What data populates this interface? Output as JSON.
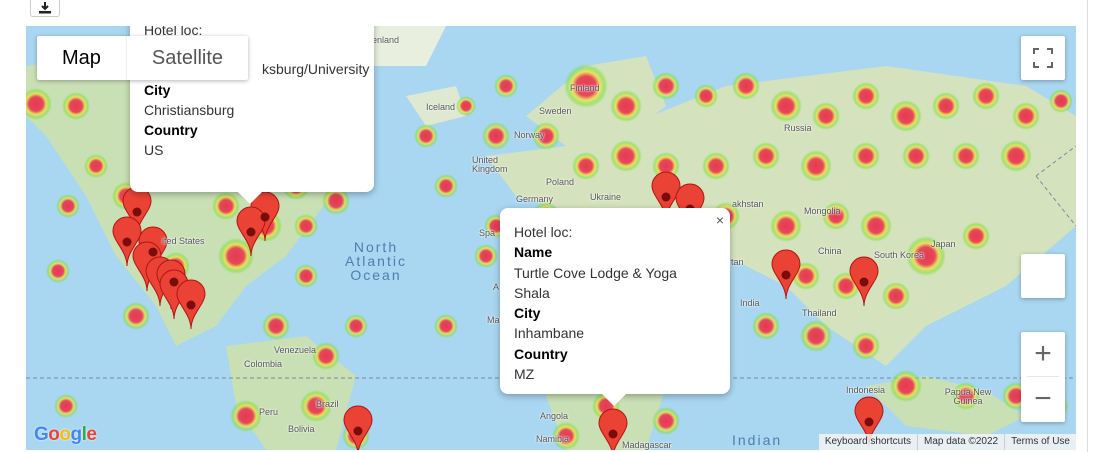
{
  "map_type": {
    "map": "Map",
    "satellite": "Satellite"
  },
  "popup_top": {
    "line1": "Hotel loc:",
    "name_value": "ksburg/University",
    "city_label": "City",
    "city_value": "Christiansburg",
    "country_label": "Country",
    "country_value": "US"
  },
  "popup_main": {
    "title": "Hotel loc:",
    "name_label": "Name",
    "name_value": "Turtle Cove Lodge & Yoga Shala",
    "city_label": "City",
    "city_value": "Inhambane",
    "country_label": "Country",
    "country_value": "MZ",
    "close": "×"
  },
  "zoom": {
    "in": "+",
    "out": "−"
  },
  "attribution": {
    "shortcuts": "Keyboard shortcuts",
    "data": "Map data ©2022",
    "terms": "Terms of Use"
  },
  "logo": "Google",
  "places": {
    "greenland": "enland",
    "iceland": "Iceland",
    "finland": "Finland",
    "sweden": "Sweden",
    "norway": "Norway",
    "russia": "Russia",
    "uk": "United Kingdom",
    "poland": "Poland",
    "germany": "Germany",
    "ukraine": "Ukraine",
    "kazakhstan": "akhstan",
    "mongolia": "Mongolia",
    "china": "China",
    "south_korea": "South Korea",
    "japan": "Japan",
    "india": "India",
    "thailand": "Thailand",
    "indonesia": "Indonesia",
    "png": "Papua New Guinea",
    "united_states": "ited States",
    "venezuela": "Venezuela",
    "colombia": "Colombia",
    "peru": "Peru",
    "brazil": "Brazil",
    "bolivia": "Bolivia",
    "angola": "Angola",
    "namibia": "Namibia",
    "madagascar": "Madagascar",
    "tan": "tan",
    "spa": "Spa",
    "ma": "Ma",
    "a": "A"
  },
  "oceans": {
    "north_atlantic": "North Atlantic Ocean",
    "indian": "Indian"
  }
}
